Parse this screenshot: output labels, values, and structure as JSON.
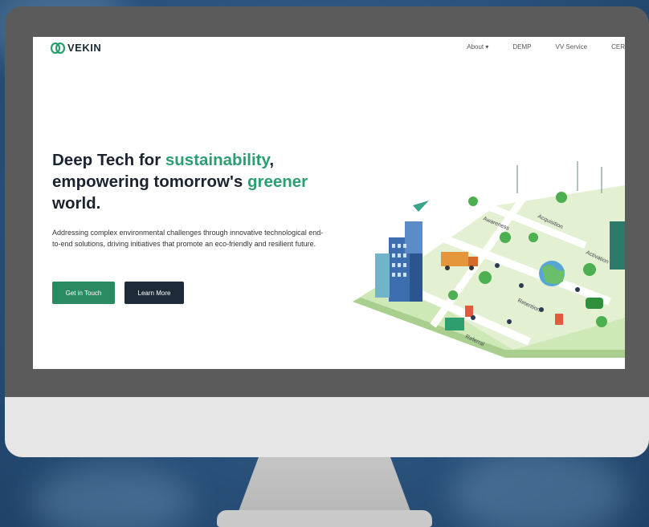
{
  "brand": {
    "name": "VEKIN"
  },
  "nav": {
    "items": [
      "About ▾",
      "DEMP",
      "VV Service",
      "CER"
    ]
  },
  "hero": {
    "title_part1": "Deep Tech for ",
    "title_highlight1": "sustainability",
    "title_part2": ", empowering tomorrow's ",
    "title_highlight2": "greener",
    "title_part3": " world.",
    "subtitle": "Addressing complex environmental challenges through innovative technological end-to-end solutions, driving initiatives that promote an eco-friendly and resilient future.",
    "primary_button": "Get in Touch",
    "secondary_button": "Learn More"
  },
  "illustration": {
    "labels": [
      "Awareness",
      "Acquisition",
      "Activation",
      "Retention",
      "Referral"
    ]
  },
  "colors": {
    "accent": "#2c9e72",
    "dark_button": "#1f2a38",
    "background": "#2d5680"
  }
}
